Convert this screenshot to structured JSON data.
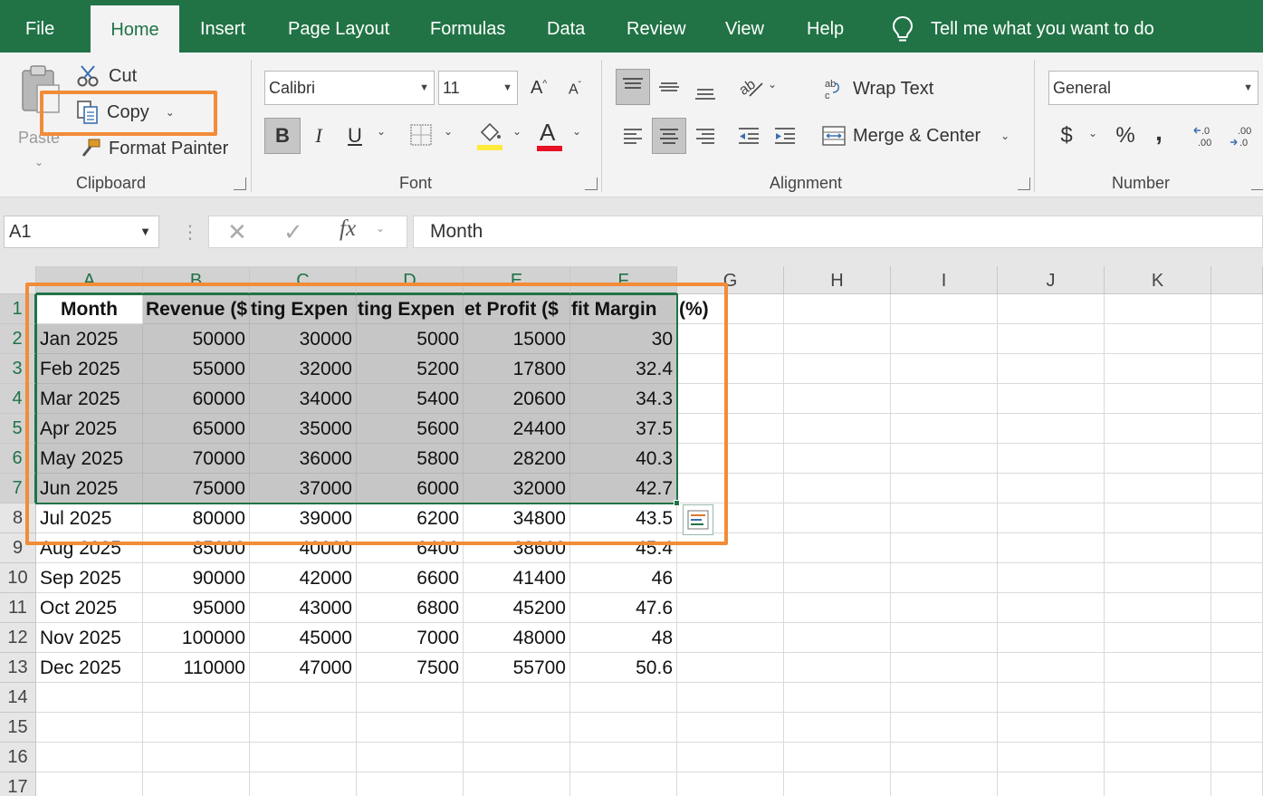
{
  "tabs": [
    "File",
    "Home",
    "Insert",
    "Page Layout",
    "Formulas",
    "Data",
    "Review",
    "View",
    "Help"
  ],
  "active_tab": "Home",
  "tell_me": "Tell me what you want to do",
  "clipboard": {
    "paste_label": "Paste",
    "cut_label": "Cut",
    "copy_label": "Copy",
    "format_painter_label": "Format Painter",
    "group_label": "Clipboard"
  },
  "font": {
    "font_name": "Calibri",
    "font_size": "11",
    "group_label": "Font",
    "bold": "B",
    "italic": "I",
    "underline": "U",
    "font_color": "#e81123",
    "fill_color": "#ffeb3b"
  },
  "alignment": {
    "wrap_text_label": "Wrap Text",
    "merge_center_label": "Merge & Center",
    "group_label": "Alignment"
  },
  "number": {
    "format": "General",
    "currency": "$",
    "percent": "%",
    "comma": ",",
    "group_label": "Number"
  },
  "formula_bar": {
    "name_box": "A1",
    "fx": "fx",
    "content": "Month"
  },
  "columns": [
    "A",
    "B",
    "C",
    "D",
    "E",
    "F",
    "G",
    "H",
    "I",
    "J",
    "K"
  ],
  "rows": [
    "1",
    "2",
    "3",
    "4",
    "5",
    "6",
    "7",
    "8",
    "9",
    "10",
    "11",
    "12",
    "13",
    "14",
    "15",
    "16",
    "17"
  ],
  "table": {
    "headers": [
      "Month",
      "Revenue ($",
      "ting Expen",
      "ting Expen",
      "et Profit ($",
      "fit Margin",
      "(%)"
    ],
    "data": [
      [
        "Jan 2025",
        "50000",
        "30000",
        "5000",
        "15000",
        "30"
      ],
      [
        "Feb 2025",
        "55000",
        "32000",
        "5200",
        "17800",
        "32.4"
      ],
      [
        "Mar 2025",
        "60000",
        "34000",
        "5400",
        "20600",
        "34.3"
      ],
      [
        "Apr 2025",
        "65000",
        "35000",
        "5600",
        "24400",
        "37.5"
      ],
      [
        "May 2025",
        "70000",
        "36000",
        "5800",
        "28200",
        "40.3"
      ],
      [
        "Jun 2025",
        "75000",
        "37000",
        "6000",
        "32000",
        "42.7"
      ],
      [
        "Jul 2025",
        "80000",
        "39000",
        "6200",
        "34800",
        "43.5"
      ],
      [
        "Aug 2025",
        "85000",
        "40000",
        "6400",
        "38600",
        "45.4"
      ],
      [
        "Sep 2025",
        "90000",
        "42000",
        "6600",
        "41400",
        "46"
      ],
      [
        "Oct 2025",
        "95000",
        "43000",
        "6800",
        "45200",
        "47.6"
      ],
      [
        "Nov 2025",
        "100000",
        "45000",
        "7000",
        "48000",
        "48"
      ],
      [
        "Dec 2025",
        "110000",
        "47000",
        "7500",
        "55700",
        "50.6"
      ]
    ]
  },
  "colors": {
    "excel_green": "#217346",
    "highlight_orange": "#f28c38",
    "selection_gray": "#c6c6c6"
  }
}
